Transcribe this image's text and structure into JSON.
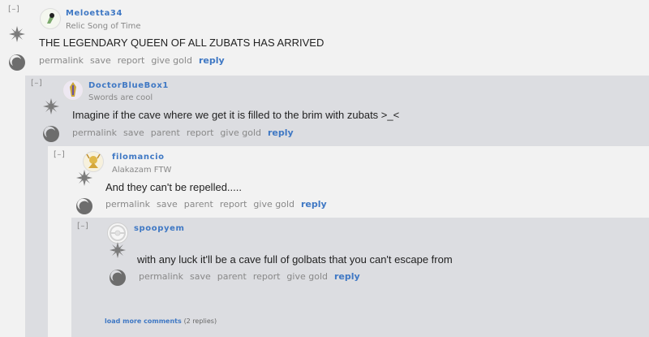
{
  "comments": [
    {
      "toggle": "[–]",
      "username": "Meloetta34",
      "flair": "Relic Song of Time",
      "body": "THE LEGENDARY QUEEN OF ALL ZUBATS HAS ARRIVED",
      "actions": [
        "permalink",
        "save",
        "report",
        "give gold",
        "reply"
      ]
    },
    {
      "toggle": "[–]",
      "username": "DoctorBlueBox1",
      "flair": "Swords are cool",
      "body": "Imagine if the cave where we get it is filled to the brim with zubats >_<",
      "actions": [
        "permalink",
        "save",
        "parent",
        "report",
        "give gold",
        "reply"
      ]
    },
    {
      "toggle": "[–]",
      "username": "filomancio",
      "flair": "Alakazam FTW",
      "body": "And they can't be repelled.....",
      "actions": [
        "permalink",
        "save",
        "parent",
        "report",
        "give gold",
        "reply"
      ]
    },
    {
      "toggle": "[–]",
      "username": "spoopyem",
      "flair": "",
      "body": "with any luck it'll be a cave full of golbats that you can't escape from",
      "actions": [
        "permalink",
        "save",
        "parent",
        "report",
        "give gold",
        "reply"
      ]
    }
  ],
  "load_more": {
    "label": "load more comments",
    "count": "(2 replies)"
  },
  "colors": {
    "link": "#3f78c4",
    "level1": "#f2f2f2",
    "level2": "#dcdde1",
    "level3": "#f2f2f2",
    "level4": "#dcdde1"
  }
}
